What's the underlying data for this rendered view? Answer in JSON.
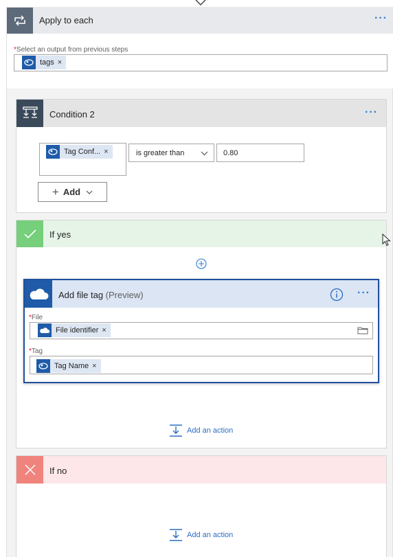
{
  "apply_to_each": {
    "title": "Apply to each",
    "more_label": "···",
    "output_label_required": "*",
    "output_label": "Select an output from previous steps",
    "token": {
      "label": "tags",
      "remove": "×",
      "icon": "expression-icon"
    }
  },
  "condition": {
    "title": "Condition 2",
    "more_label": "···",
    "left_token": {
      "label": "Tag Conf...",
      "remove": "×",
      "icon": "expression-icon"
    },
    "operator": "is greater than",
    "value": "0.80",
    "add_label": "Add",
    "add_icon": "+",
    "add_chevron": "˅"
  },
  "if_yes": {
    "title": "If yes",
    "action_card": {
      "title": "Add file tag",
      "preview": "(Preview)",
      "more_label": "···",
      "file": {
        "required": "*",
        "label": "File",
        "token": {
          "label": "File identifier",
          "remove": "×",
          "icon": "onedrive-cloud-icon"
        }
      },
      "tag": {
        "required": "*",
        "label": "Tag",
        "token": {
          "label": "Tag Name",
          "remove": "×",
          "icon": "expression-icon"
        }
      }
    },
    "add_action_label": "Add an action"
  },
  "if_no": {
    "title": "If no",
    "add_action_label": "Add an action"
  },
  "colors": {
    "accent": "#2b7bd3",
    "token_bg": "#dde6f3",
    "yes_green": "#76cf7a",
    "no_red": "#f1837d",
    "card_border": "#1f4e9c"
  }
}
